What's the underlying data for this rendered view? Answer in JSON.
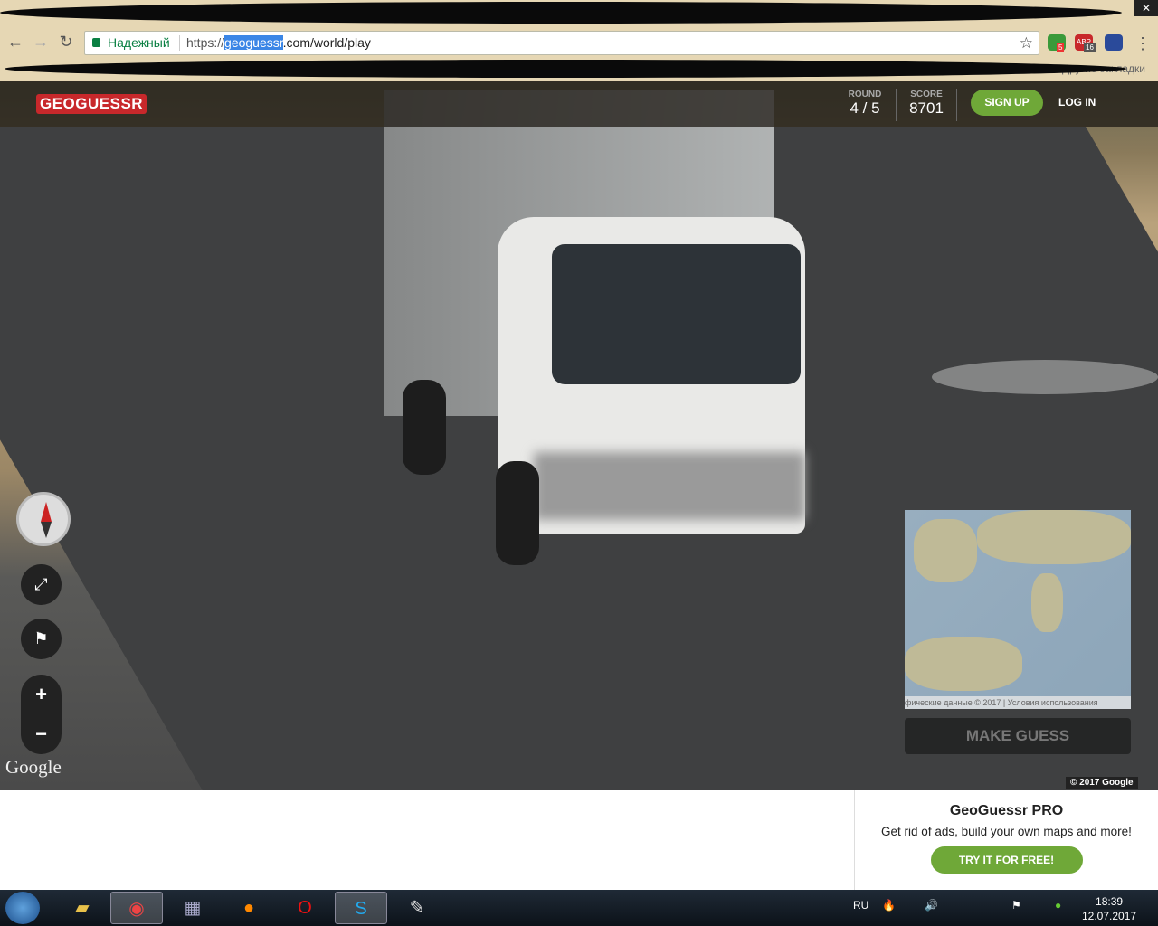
{
  "browser": {
    "secure_label": "Надежный",
    "url_scheme": "https://",
    "url_highlight": "geoguessr",
    "url_rest": ".com/world/play",
    "other_bookmarks": "Другие закладки",
    "extensions": [
      {
        "name": "translate-extension",
        "badge": "5",
        "color": "#3a9a3a"
      },
      {
        "name": "adblock-extension",
        "label": "ABP",
        "badge": "16",
        "color": "#c8282b"
      },
      {
        "name": "vk-music-extension",
        "color": "#2a4a9a"
      }
    ]
  },
  "header": {
    "logo": "GEOGUESSR",
    "round_label": "ROUND",
    "round_value": "4 / 5",
    "score_label": "SCORE",
    "score_value": "8701",
    "signup": "SIGN UP",
    "login": "LOG IN",
    "brand_color": "#c8282b",
    "accent": "#6fa838"
  },
  "streetview": {
    "google": "Google",
    "copyright": "© 2017 Google"
  },
  "map": {
    "attribution": "фические данные © 2017 | Условия использования",
    "make_guess": "MAKE GUESS"
  },
  "promo": {
    "title": "GeoGuessr PRO",
    "text": "Get rid of ads, build your own maps and more!",
    "cta": "TRY IT FOR FREE!"
  },
  "taskbar": {
    "lang": "RU",
    "time": "18:39",
    "date": "12.07.2017"
  }
}
